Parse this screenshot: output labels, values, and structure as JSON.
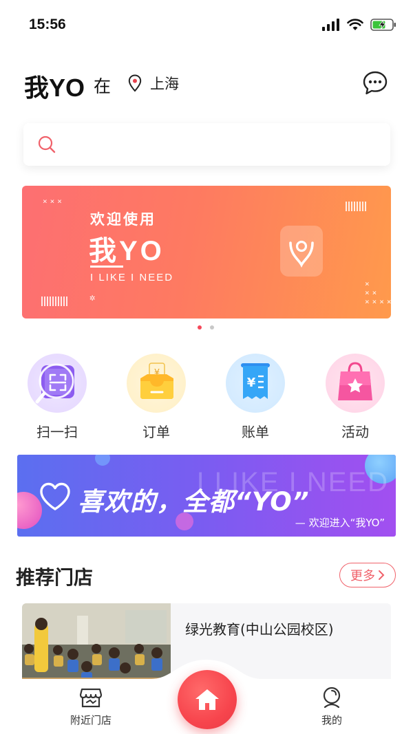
{
  "status_bar": {
    "time": "15:56",
    "icons": [
      "signal-icon",
      "wifi-icon",
      "battery-charging-icon"
    ]
  },
  "header": {
    "title": "我YO",
    "title_suffix": "在",
    "location": "上海",
    "location_icon": "location-pin-icon",
    "message_icon": "chat-bubble-icon"
  },
  "search": {
    "placeholder": "",
    "icon": "search-icon",
    "accent": "#f0616a"
  },
  "banner": {
    "welcome": "欢迎使用",
    "brand": "我YO",
    "slogan": "I LIKE I NEED",
    "colors": [
      "#fd6f72",
      "#ff9a4c"
    ],
    "pagination": {
      "count": 2,
      "active": 0
    }
  },
  "quick_menu": [
    {
      "label": "扫一扫",
      "icon": "scan-icon",
      "color": "#8a5cf0"
    },
    {
      "label": "订单",
      "icon": "order-icon",
      "color": "#ffbf3a"
    },
    {
      "label": "账单",
      "icon": "bill-icon",
      "color": "#3aa3f5"
    },
    {
      "label": "活动",
      "icon": "gift-bag-icon",
      "color": "#f4509a"
    }
  ],
  "promo": {
    "main_text": "喜欢的，全都“YO”",
    "watermark": "I LIKE I NEED",
    "sub_text": "— 欢迎进入“我YO”",
    "icon": "heart-icon"
  },
  "recommend": {
    "title": "推荐门店",
    "more_label": "更多",
    "stores": [
      {
        "name": "绿光教育(中山公园校区)"
      }
    ]
  },
  "bottom_nav": {
    "items": [
      {
        "label": "附近门店",
        "icon": "store-icon"
      },
      {
        "label": "",
        "icon": "home-icon"
      },
      {
        "label": "我的",
        "icon": "user-icon"
      }
    ],
    "accent": "#f7454d"
  }
}
